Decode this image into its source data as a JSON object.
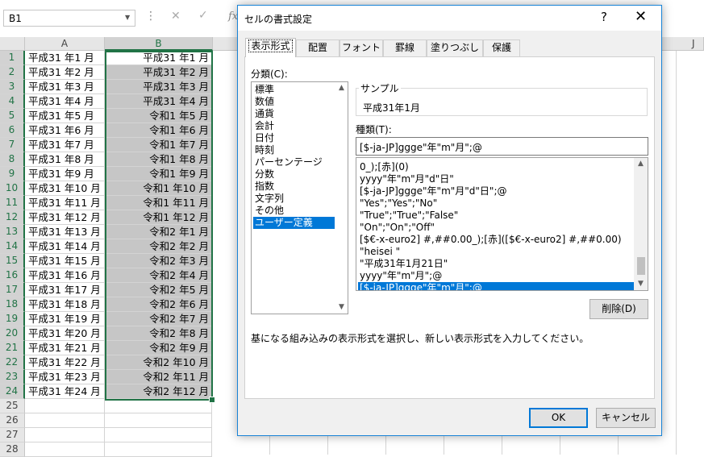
{
  "formula_bar": {
    "name_box": "B1",
    "dots": "⋮",
    "cancel_glyph": "✕",
    "enter_glyph": "✓",
    "fx": "fx"
  },
  "sheet": {
    "columns": [
      "A",
      "B"
    ],
    "partial_column": "J",
    "rows": [
      {
        "n": "1",
        "a": "平成31 年1 月",
        "b": "平成31 年1 月"
      },
      {
        "n": "2",
        "a": "平成31 年2 月",
        "b": "平成31 年2 月"
      },
      {
        "n": "3",
        "a": "平成31 年3 月",
        "b": "平成31 年3 月"
      },
      {
        "n": "4",
        "a": "平成31 年4 月",
        "b": "平成31 年4 月"
      },
      {
        "n": "5",
        "a": "平成31 年5 月",
        "b": "令和1 年5 月"
      },
      {
        "n": "6",
        "a": "平成31 年6 月",
        "b": "令和1 年6 月"
      },
      {
        "n": "7",
        "a": "平成31 年7 月",
        "b": "令和1 年7 月"
      },
      {
        "n": "8",
        "a": "平成31 年8 月",
        "b": "令和1 年8 月"
      },
      {
        "n": "9",
        "a": "平成31 年9 月",
        "b": "令和1 年9 月"
      },
      {
        "n": "10",
        "a": "平成31 年10 月",
        "b": "令和1 年10 月"
      },
      {
        "n": "11",
        "a": "平成31 年11 月",
        "b": "令和1 年11 月"
      },
      {
        "n": "12",
        "a": "平成31 年12 月",
        "b": "令和1 年12 月"
      },
      {
        "n": "13",
        "a": "平成31 年13 月",
        "b": "令和2 年1 月"
      },
      {
        "n": "14",
        "a": "平成31 年14 月",
        "b": "令和2 年2 月"
      },
      {
        "n": "15",
        "a": "平成31 年15 月",
        "b": "令和2 年3 月"
      },
      {
        "n": "16",
        "a": "平成31 年16 月",
        "b": "令和2 年4 月"
      },
      {
        "n": "17",
        "a": "平成31 年17 月",
        "b": "令和2 年5 月"
      },
      {
        "n": "18",
        "a": "平成31 年18 月",
        "b": "令和2 年6 月"
      },
      {
        "n": "19",
        "a": "平成31 年19 月",
        "b": "令和2 年7 月"
      },
      {
        "n": "20",
        "a": "平成31 年20 月",
        "b": "令和2 年8 月"
      },
      {
        "n": "21",
        "a": "平成31 年21 月",
        "b": "令和2 年9 月"
      },
      {
        "n": "22",
        "a": "平成31 年22 月",
        "b": "令和2 年10 月"
      },
      {
        "n": "23",
        "a": "平成31 年23 月",
        "b": "令和2 年11 月"
      },
      {
        "n": "24",
        "a": "平成31 年24 月",
        "b": "令和2 年12 月"
      },
      {
        "n": "25",
        "a": "",
        "b": ""
      },
      {
        "n": "26",
        "a": "",
        "b": ""
      },
      {
        "n": "27",
        "a": "",
        "b": ""
      },
      {
        "n": "28",
        "a": "",
        "b": ""
      }
    ]
  },
  "dialog": {
    "title": "セルの書式設定",
    "help": "?",
    "close": "✕",
    "tabs": [
      "表示形式",
      "配置",
      "フォント",
      "罫線",
      "塗りつぶし",
      "保護"
    ],
    "category_label": "分類(C):",
    "categories": [
      "標準",
      "数値",
      "通貨",
      "会計",
      "日付",
      "時刻",
      "パーセンテージ",
      "分数",
      "指数",
      "文字列",
      "その他",
      "ユーザー定義"
    ],
    "selected_category": "ユーザー定義",
    "sample_label": "サンプル",
    "sample_value": "平成31年1月",
    "type_label": "種類(T):",
    "type_value": "[$-ja-JP]ggge\"年\"m\"月\";@",
    "formats": [
      "0_);[赤](0)",
      "yyyy\"年\"m\"月\"d\"日\"",
      "[$-ja-JP]ggge\"年\"m\"月\"d\"日\";@",
      "\"Yes\";\"Yes\";\"No\"",
      "\"True\";\"True\";\"False\"",
      "\"On\";\"On\";\"Off\"",
      "[$€-x-euro2] #,##0.00_);[赤]([$€-x-euro2] #,##0.00)",
      "\"heisei \"",
      "\"平成31年1月21日\"",
      "yyyy\"年\"m\"月\";@",
      "[$-ja-JP]ggge\"年\"m\"月\";@"
    ],
    "selected_format": "[$-ja-JP]ggge\"年\"m\"月\";@",
    "delete_label": "削除(D)",
    "hint": "基になる組み込みの表示形式を選択し、新しい表示形式を入力してください。",
    "ok_label": "OK",
    "cancel_label": "キャンセル"
  },
  "colors": {
    "excel_green": "#217346",
    "selection_blue": "#0078d7",
    "selection_fill": "#c6c6c6"
  }
}
